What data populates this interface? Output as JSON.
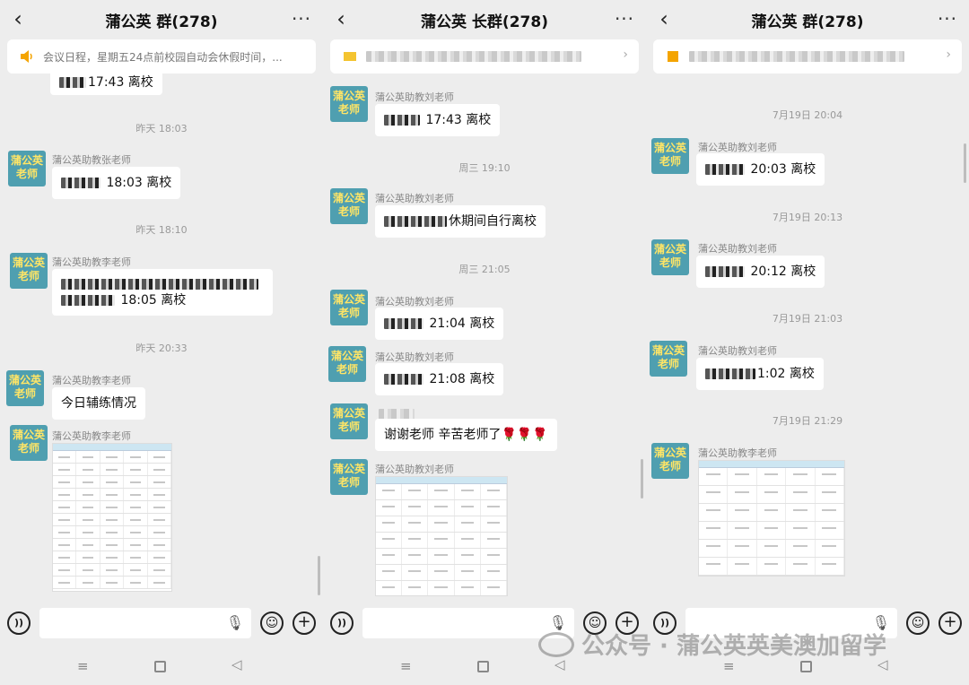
{
  "screens": [
    {
      "title": "蒲公英 群(278)",
      "notice": "会议日程，星期五24点前校园自动会休假时间，...",
      "messages": [
        {
          "time": "昨天 18:03",
          "sender": "蒲公英助教张老师",
          "text": "18:03 离校"
        },
        {
          "time": "昨天 18:10",
          "sender": "蒲公英助教李老师",
          "text": "18:05 离校"
        },
        {
          "time": "昨天 20:33",
          "sender": "蒲公英助教李老师",
          "text": "今日辅练情况"
        },
        {
          "sender": "蒲公英助教李老师"
        }
      ],
      "top_partial": "17:43 离校"
    },
    {
      "title": "蒲公英 长群(278)",
      "messages": [
        {
          "sender": "蒲公英助教刘老师",
          "text": "17:43 离校"
        },
        {
          "time": "周三 19:10",
          "sender": "蒲公英助教刘老师",
          "text": "休期间自行离校"
        },
        {
          "time": "周三 21:05",
          "sender": "蒲公英助教刘老师",
          "text": "21:04 离校"
        },
        {
          "sender": "蒲公英助教刘老师",
          "text": "21:08 离校"
        },
        {
          "text": "谢谢老师 辛苦老师了🌹🌹🌹"
        },
        {
          "sender": "蒲公英助教刘老师"
        }
      ]
    },
    {
      "title": "蒲公英 群(278)",
      "messages": [
        {
          "time": "7月19日 20:04",
          "sender": "蒲公英助教刘老师",
          "text": "20:03 离校"
        },
        {
          "time": "7月19日 20:13",
          "sender": "蒲公英助教刘老师",
          "text": "20:12 离校"
        },
        {
          "time": "7月19日 21:03",
          "sender": "蒲公英助教刘老师",
          "text": "1:02 离校"
        },
        {
          "time": "7月19日 21:29",
          "sender": "蒲公英助教李老师"
        }
      ]
    }
  ],
  "avatar": {
    "line1": "蒲公英",
    "line2": "老师"
  },
  "icons": {
    "back": "chevron-left-icon",
    "more": "more-dots-icon",
    "voice": "voice-icon",
    "emoji": "emoji-icon",
    "plus": "plus-icon",
    "mic": "mic-icon"
  },
  "watermark": "公众号 · 蒲公英英美澳加留学",
  "colors": {
    "avatar_bg": "#4f9fb0",
    "avatar_text": "#ffe566",
    "notice_icon": "#f4a400"
  }
}
